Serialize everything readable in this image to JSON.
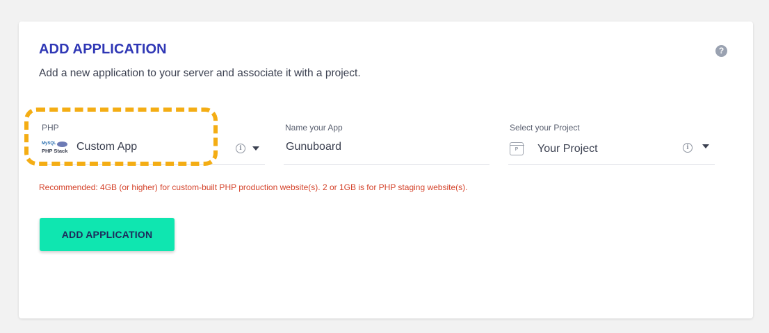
{
  "header": {
    "title": "ADD APPLICATION",
    "subtitle": "Add a new application to your server and associate it with a project.",
    "help_icon": "question-circle-icon"
  },
  "application_select": {
    "label": "PHP",
    "value": "Custom App",
    "logo_top_left": "MySQL",
    "logo_text": "PHP Stack",
    "info_icon": "info-icon",
    "caret_icon": "caret-down-icon"
  },
  "app_name": {
    "label": "Name your App",
    "value": "Gunuboard"
  },
  "project_select": {
    "label": "Select your Project",
    "value": "Your Project",
    "icon_letter": "P",
    "info_icon": "info-icon",
    "caret_icon": "caret-down-icon"
  },
  "recommendation": "Recommended: 4GB (or higher) for custom-built PHP production website(s). 2 or 1GB is for PHP staging website(s).",
  "submit_button": {
    "label": "ADD APPLICATION"
  },
  "colors": {
    "title": "#2f37b5",
    "highlight": "#f4ad14",
    "button": "#0fe6b0",
    "warning": "#d4422a"
  }
}
